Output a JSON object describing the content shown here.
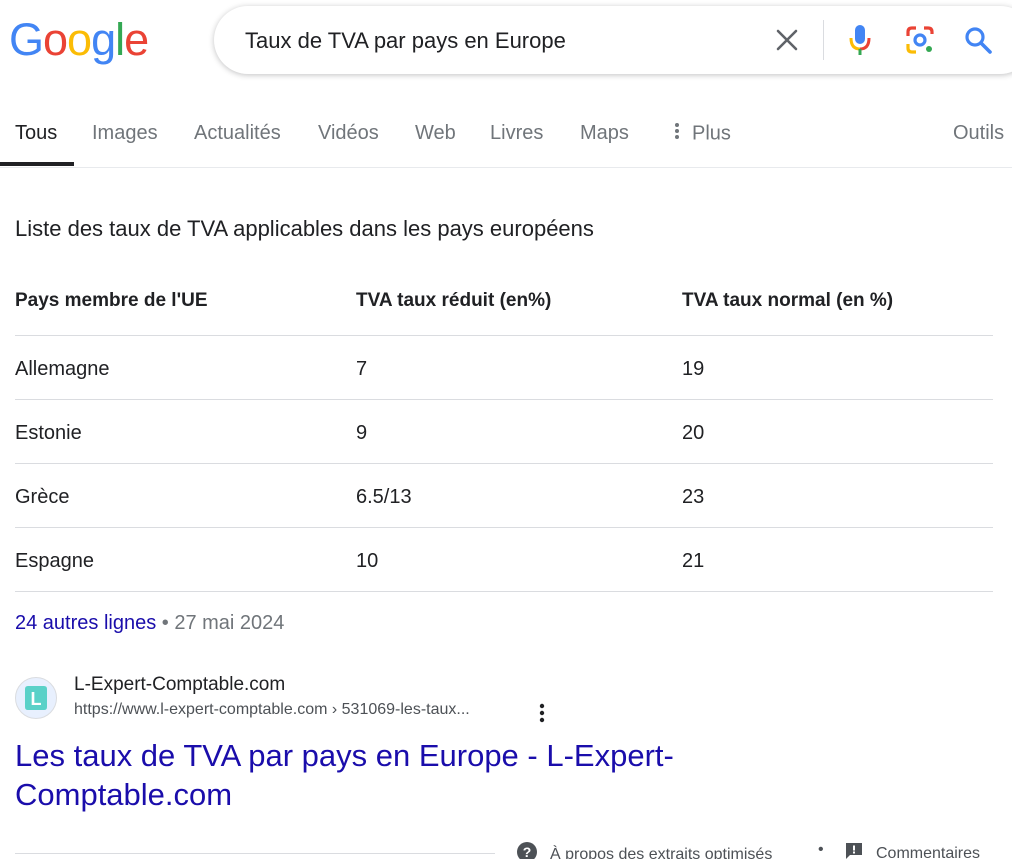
{
  "logo": {
    "letters": [
      "G",
      "o",
      "o",
      "g",
      "l",
      "e"
    ],
    "colors": [
      "#4285f4",
      "#ea4335",
      "#fbbc05",
      "#4285f4",
      "#34a853",
      "#ea4335"
    ]
  },
  "search": {
    "query": "Taux de TVA par pays en Europe"
  },
  "tabs": [
    {
      "label": "Tous"
    },
    {
      "label": "Images"
    },
    {
      "label": "Actualités"
    },
    {
      "label": "Vidéos"
    },
    {
      "label": "Web"
    },
    {
      "label": "Livres"
    },
    {
      "label": "Maps"
    },
    {
      "label": "Plus"
    }
  ],
  "tools_label": "Outils",
  "snippet": {
    "title": "Liste des taux de TVA applicables dans les pays européens",
    "headers": [
      "Pays membre de l'UE",
      "TVA taux réduit (en%)",
      "TVA taux normal (en %)"
    ],
    "rows": [
      [
        "Allemagne",
        "7",
        "19"
      ],
      [
        "Estonie",
        "9",
        "20"
      ],
      [
        "Grèce",
        "6.5/13",
        "23"
      ],
      [
        "Espagne",
        "10",
        "21"
      ]
    ],
    "more_link": "24 autres lignes",
    "date": " • 27 mai 2024"
  },
  "source": {
    "favicon_letter": "L",
    "name": "L-Expert-Comptable.com",
    "url": "https://www.l-expert-comptable.com › 531069-les-taux...",
    "title": "Les taux de TVA par pays en Europe - L-Expert-Comptable.com"
  },
  "footer": {
    "about": "À propos des extraits optimisés",
    "separator": "•",
    "feedback": "Commentaires"
  },
  "colors": {
    "link": "#1a0dab",
    "text": "#202124",
    "muted": "#70757a",
    "favicon": "#5ad1c8"
  }
}
